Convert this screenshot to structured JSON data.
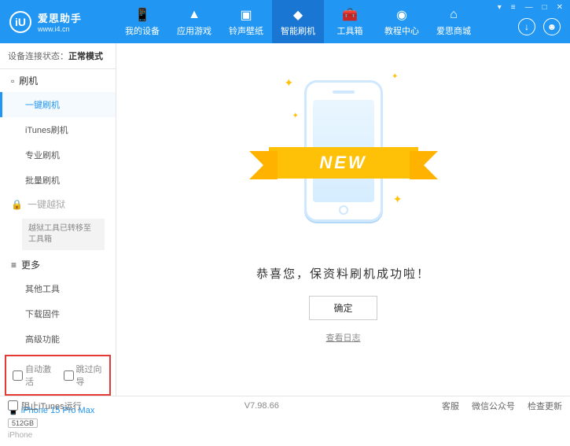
{
  "logo": {
    "icon": "iU",
    "title": "爱思助手",
    "subtitle": "www.i4.cn"
  },
  "nav": [
    {
      "label": "我的设备"
    },
    {
      "label": "应用游戏"
    },
    {
      "label": "铃声壁纸"
    },
    {
      "label": "智能刷机"
    },
    {
      "label": "工具箱"
    },
    {
      "label": "教程中心"
    },
    {
      "label": "爱思商城"
    }
  ],
  "status": {
    "prefix": "设备连接状态：",
    "mode": "正常模式"
  },
  "sidebar": {
    "flash": {
      "header": "刷机",
      "items": [
        "一键刷机",
        "iTunes刷机",
        "专业刷机",
        "批量刷机"
      ]
    },
    "jailbreak": {
      "header": "一键越狱",
      "note": "越狱工具已转移至工具箱"
    },
    "more": {
      "header": "更多",
      "items": [
        "其他工具",
        "下载固件",
        "高级功能"
      ]
    }
  },
  "checkboxes": {
    "auto_activate": "自动激活",
    "skip_guide": "跳过向导"
  },
  "device": {
    "name": "iPhone 15 Pro Max",
    "storage": "512GB",
    "model": "iPhone"
  },
  "main": {
    "ribbon": "NEW",
    "success": "恭喜您，保资料刷机成功啦！",
    "confirm": "确定",
    "log": "查看日志"
  },
  "footer": {
    "block_itunes": "阻止iTunes运行",
    "version": "V7.98.66",
    "links": [
      "客服",
      "微信公众号",
      "检查更新"
    ]
  }
}
